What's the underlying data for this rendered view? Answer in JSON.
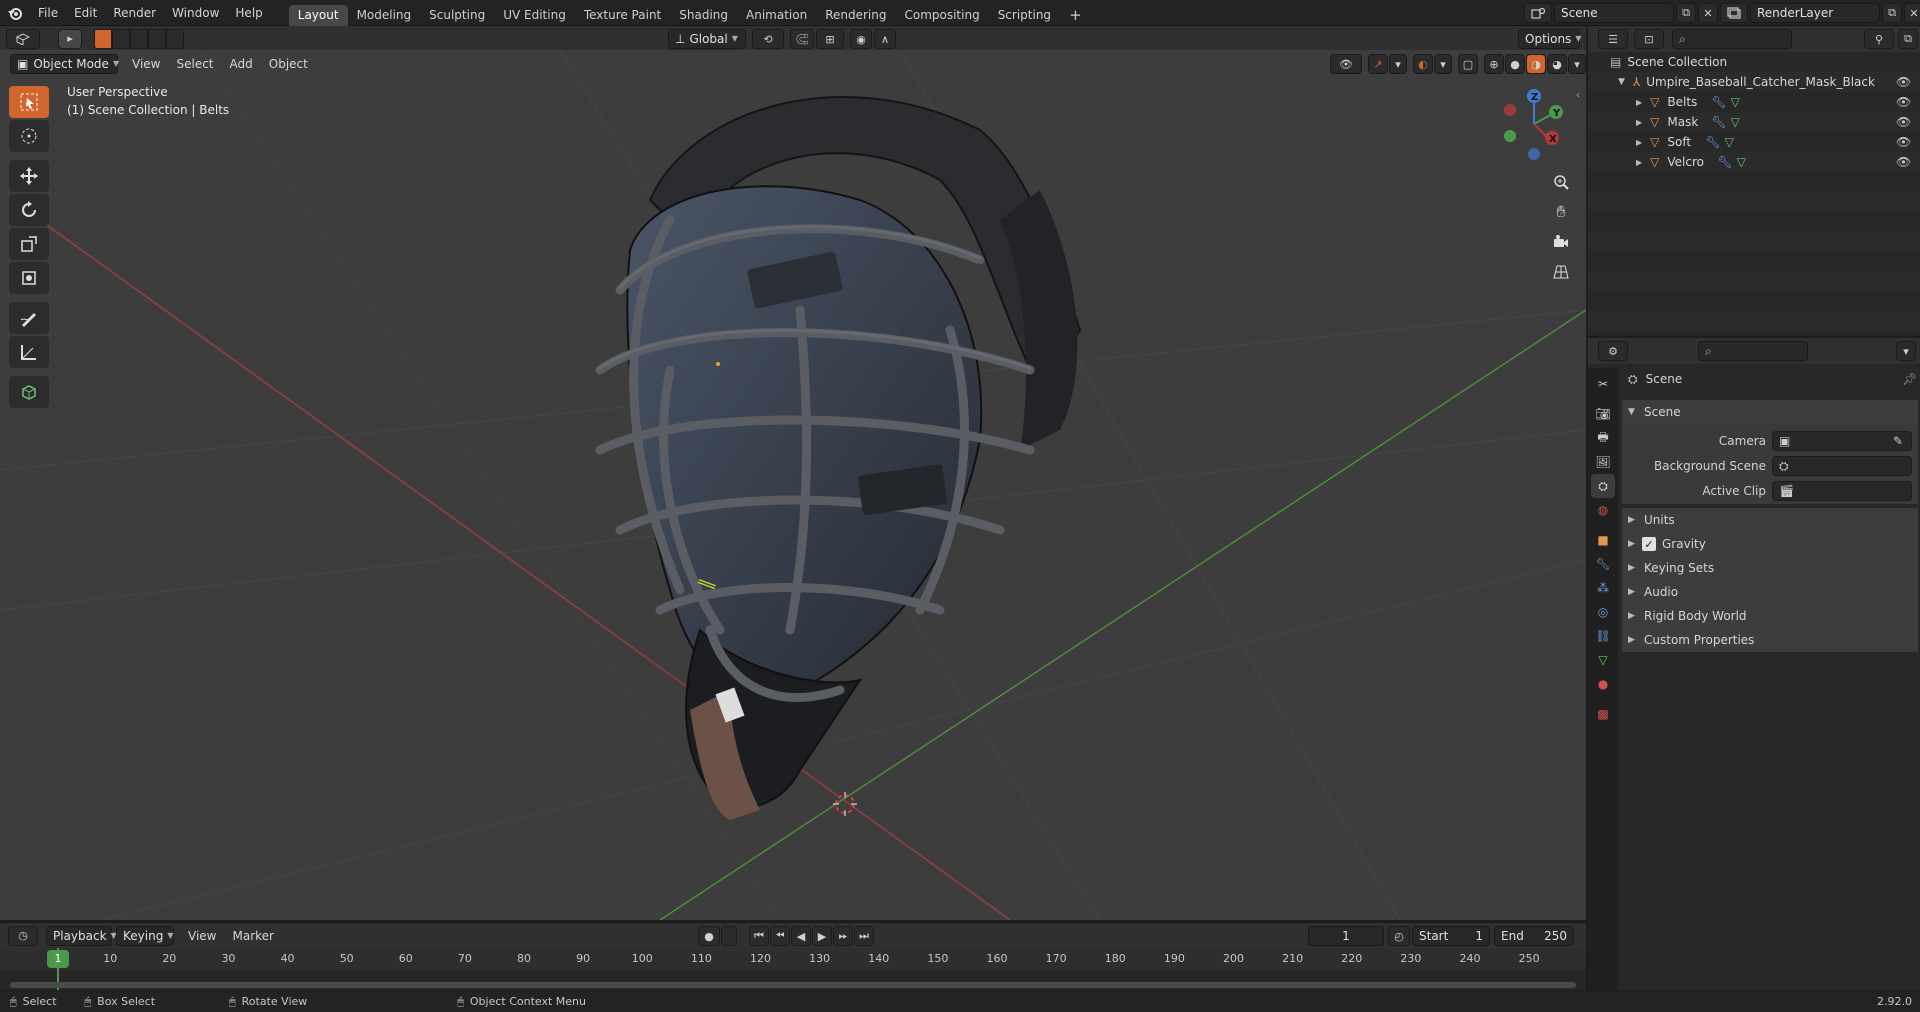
{
  "topbar": {
    "menus": [
      "File",
      "Edit",
      "Render",
      "Window",
      "Help"
    ],
    "workspaces": [
      "Layout",
      "Modeling",
      "Sculpting",
      "UV Editing",
      "Texture Paint",
      "Shading",
      "Animation",
      "Rendering",
      "Compositing",
      "Scripting"
    ],
    "active_workspace": "Layout",
    "scene_name": "Scene",
    "render_layer": "RenderLayer",
    "add_tab_label": "+"
  },
  "viewport": {
    "mode": "Object Mode",
    "menus": [
      "View",
      "Select",
      "Add",
      "Object"
    ],
    "orientation": "Global",
    "options_label": "Options",
    "perspective_label": "User Perspective",
    "collection_label": "(1) Scene Collection | Belts",
    "axis_labels": {
      "x": "X",
      "y": "Y",
      "z": "Z"
    }
  },
  "outliner": {
    "root": "Scene Collection",
    "collection": "Umpire_Baseball_Catcher_Mask_Black",
    "objects": [
      "Belts",
      "Mask",
      "Soft",
      "Velcro"
    ]
  },
  "properties": {
    "context": "Scene",
    "section": "Scene",
    "fields": [
      {
        "label": "Camera",
        "value": ""
      },
      {
        "label": "Background Scene",
        "value": ""
      },
      {
        "label": "Active Clip",
        "value": ""
      }
    ],
    "panels": [
      "Units",
      "Gravity",
      "Keying Sets",
      "Audio",
      "Rigid Body World",
      "Custom Properties"
    ],
    "gravity_checked": true
  },
  "timeline": {
    "menus": [
      "Playback",
      "Keying",
      "View",
      "Marker"
    ],
    "current_frame": "1",
    "start_label": "Start",
    "start_value": "1",
    "end_label": "End",
    "end_value": "250",
    "ruler": [
      "10",
      "20",
      "30",
      "40",
      "50",
      "60",
      "70",
      "80",
      "90",
      "100",
      "110",
      "120",
      "130",
      "140",
      "150",
      "160",
      "170",
      "180",
      "190",
      "200",
      "210",
      "220",
      "230",
      "240",
      "250"
    ],
    "playhead_label": "1"
  },
  "statusbar": {
    "select": "Select",
    "box_select": "Box Select",
    "rotate_view": "Rotate View",
    "context_menu": "Object Context Menu",
    "version": "2.92.0"
  },
  "colors": {
    "accent": "#d0662d",
    "x_axis": "#b33a3a",
    "y_axis": "#4a9a4a",
    "z_axis": "#3e7bd1"
  }
}
